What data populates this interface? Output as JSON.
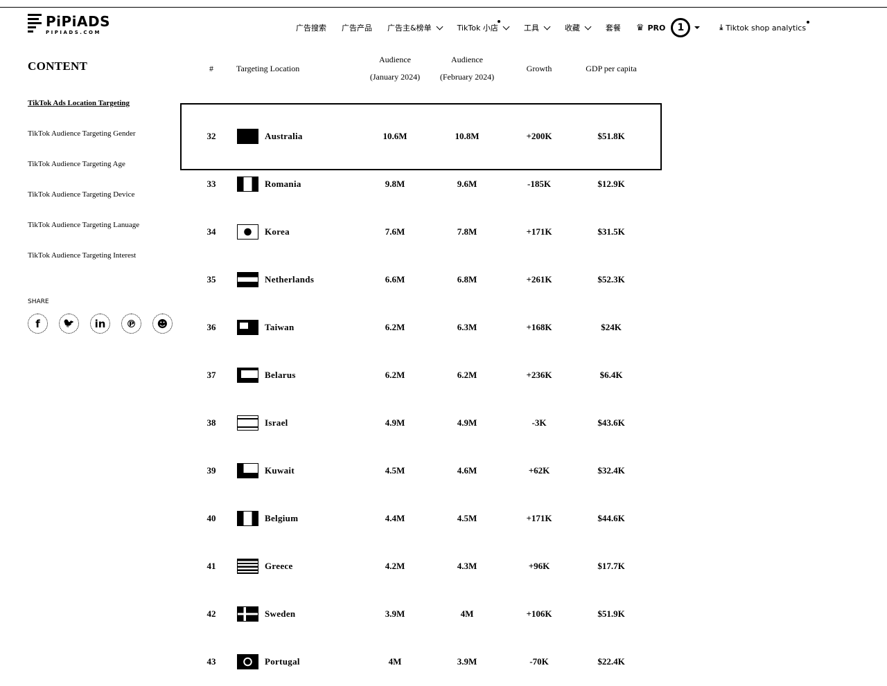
{
  "header": {
    "logo": {
      "name": "PiPiADS",
      "domain": "PIPIADS.COM"
    },
    "nav": [
      {
        "label": "广告搜索",
        "chevron": false,
        "dot": false
      },
      {
        "label": "广告产品",
        "chevron": false,
        "dot": false
      },
      {
        "label": "广告主&榜单",
        "chevron": true,
        "dot": false
      },
      {
        "label": "TikTok 小店",
        "chevron": true,
        "dot": true
      },
      {
        "label": "工具",
        "chevron": true,
        "dot": false
      },
      {
        "label": "收藏",
        "chevron": true,
        "dot": false
      },
      {
        "label": "套餐",
        "chevron": false,
        "dot": false
      }
    ],
    "pro_label": "PRO",
    "avatar_text": "1",
    "shop_analytics_label": "Tiktok shop analytics"
  },
  "sidebar": {
    "title": "CONTENT",
    "items": [
      {
        "label": "TikTok Ads Location Targeting",
        "active": true
      },
      {
        "label": "TikTok Audience Targeting Gender",
        "active": false
      },
      {
        "label": "TikTok Audience Targeting Age",
        "active": false
      },
      {
        "label": "TikTok Audience Targeting Device",
        "active": false
      },
      {
        "label": "TikTok Audience Targeting Lanuage",
        "active": false
      },
      {
        "label": "TikTok Audience Targeting Interest",
        "active": false
      }
    ],
    "share_label": "SHARE",
    "share_icons": [
      "facebook-icon",
      "twitter-icon",
      "linkedin-icon",
      "pinterest-icon",
      "reddit-icon"
    ]
  },
  "table": {
    "headers": {
      "rank": "#",
      "location": "Targeting Location",
      "jan_1": "Audience",
      "jan_2": "(January 2024)",
      "feb_1": "Audience",
      "feb_2": "(February 2024)",
      "growth": "Growth",
      "gdp": "GDP per capita"
    },
    "rows": [
      {
        "rank": "32",
        "flag": "australia",
        "location": "Australia",
        "jan": "10.6M",
        "feb": "10.8M",
        "growth": "+200K",
        "gdp": "$51.8K",
        "highlighted": true
      },
      {
        "rank": "33",
        "flag": "romania",
        "location": "Romania",
        "jan": "9.8M",
        "feb": "9.6M",
        "growth": "-185K",
        "gdp": "$12.9K"
      },
      {
        "rank": "34",
        "flag": "korea",
        "location": "Korea",
        "jan": "7.6M",
        "feb": "7.8M",
        "growth": "+171K",
        "gdp": "$31.5K"
      },
      {
        "rank": "35",
        "flag": "netherlands",
        "location": "Netherlands",
        "jan": "6.6M",
        "feb": "6.8M",
        "growth": "+261K",
        "gdp": "$52.3K"
      },
      {
        "rank": "36",
        "flag": "taiwan",
        "location": "Taiwan",
        "jan": "6.2M",
        "feb": "6.3M",
        "growth": "+168K",
        "gdp": "$24K"
      },
      {
        "rank": "37",
        "flag": "belarus",
        "location": "Belarus",
        "jan": "6.2M",
        "feb": "6.2M",
        "growth": "+236K",
        "gdp": "$6.4K"
      },
      {
        "rank": "38",
        "flag": "israel",
        "location": "Israel",
        "jan": "4.9M",
        "feb": "4.9M",
        "growth": "-3K",
        "gdp": "$43.6K"
      },
      {
        "rank": "39",
        "flag": "kuwait",
        "location": "Kuwait",
        "jan": "4.5M",
        "feb": "4.6M",
        "growth": "+62K",
        "gdp": "$32.4K"
      },
      {
        "rank": "40",
        "flag": "belgium",
        "location": "Belgium",
        "jan": "4.4M",
        "feb": "4.5M",
        "growth": "+171K",
        "gdp": "$44.6K"
      },
      {
        "rank": "41",
        "flag": "greece",
        "location": "Greece",
        "jan": "4.2M",
        "feb": "4.3M",
        "growth": "+96K",
        "gdp": "$17.7K"
      },
      {
        "rank": "42",
        "flag": "sweden",
        "location": "Sweden",
        "jan": "3.9M",
        "feb": "4M",
        "growth": "+106K",
        "gdp": "$51.9K"
      },
      {
        "rank": "43",
        "flag": "portugal",
        "location": "Portugal",
        "jan": "4M",
        "feb": "3.9M",
        "growth": "-70K",
        "gdp": "$22.4K"
      }
    ]
  }
}
